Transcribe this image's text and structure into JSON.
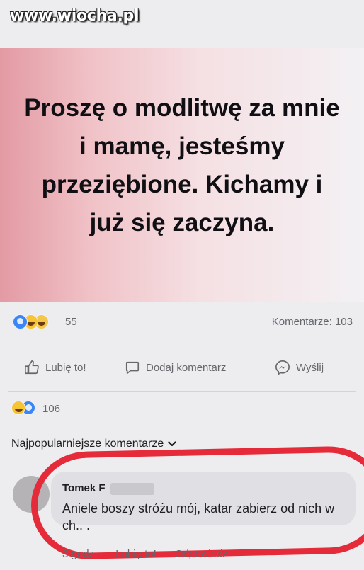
{
  "watermark": "www.wiocha.pl",
  "post": {
    "text": "Proszę o modlitwę za mnie i mamę, jesteśmy przeziębione. Kichamy i już się zaczyna."
  },
  "reactions": {
    "icons": [
      "like-icon",
      "haha-icon",
      "sad-icon"
    ],
    "count": "55",
    "comments": "Komentarze: 103"
  },
  "actions": {
    "like": "Lubię to!",
    "comment": "Dodaj komentarz",
    "send": "Wyślij"
  },
  "comment_reactions": {
    "icons": [
      "haha-icon",
      "like-icon"
    ],
    "count": "106"
  },
  "sort": {
    "label": "Najpopularniejsze komentarze"
  },
  "comment": {
    "author": "Tomek F",
    "text": "Aniele boszy stróżu mój, katar zabierz od nich w ch.. .",
    "time": "3 godz.",
    "like": "Lubię to!",
    "reply": "Odpowiedz"
  },
  "colors": {
    "highlight_oval": "#e52a3a",
    "like_blue": "#3b86f7"
  }
}
